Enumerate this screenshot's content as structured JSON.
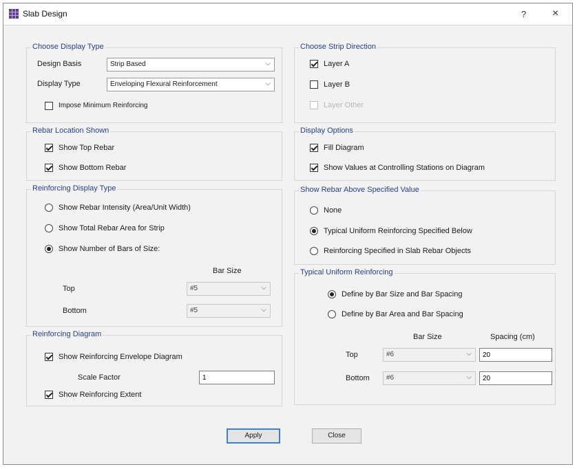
{
  "window": {
    "title": "Slab Design",
    "help_label": "?",
    "close_label": "×"
  },
  "display_type_group": {
    "title": "Choose Display Type",
    "design_basis_label": "Design Basis",
    "design_basis_value": "Strip Based",
    "display_type_label": "Display Type",
    "display_type_value": "Enveloping Flexural Reinforcement",
    "impose_min_label": "Impose Minimum Reinforcing",
    "impose_min_checked": false
  },
  "strip_direction_group": {
    "title": "Choose Strip Direction",
    "layer_a_label": "Layer A",
    "layer_a_checked": true,
    "layer_b_label": "Layer B",
    "layer_b_checked": false,
    "layer_other_label": "Layer Other",
    "layer_other_enabled": false
  },
  "rebar_location_group": {
    "title": "Rebar Location Shown",
    "show_top_label": "Show Top Rebar",
    "show_top_checked": true,
    "show_bottom_label": "Show Bottom Rebar",
    "show_bottom_checked": true
  },
  "display_options_group": {
    "title": "Display Options",
    "fill_diagram_label": "Fill Diagram",
    "fill_diagram_checked": true,
    "show_values_label": "Show Values at Controlling Stations on Diagram",
    "show_values_checked": true
  },
  "reinforcing_display_group": {
    "title": "Reinforcing Display Type",
    "option1_label": "Show Rebar Intensity (Area/Unit Width)",
    "option2_label": "Show Total Rebar Area for Strip",
    "option3_label": "Show Number of Bars of Size:",
    "selected_option": 3,
    "bar_size_header": "Bar Size",
    "top_label": "Top",
    "top_bar_size": "#5",
    "bottom_label": "Bottom",
    "bottom_bar_size": "#5"
  },
  "show_rebar_above_group": {
    "title": "Show Rebar Above Specified Value",
    "option_none_label": "None",
    "option_typical_label": "Typical Uniform Reinforcing Specified Below",
    "option_slab_rebar_label": "Reinforcing Specified in Slab Rebar Objects",
    "selected_option": 2
  },
  "typical_uniform_group": {
    "title": "Typical Uniform Reinforcing",
    "define_bar_size_label": "Define by Bar Size and Bar Spacing",
    "define_bar_area_label": "Define by Bar Area and Bar Spacing",
    "selected_option": 1,
    "bar_size_header": "Bar Size",
    "spacing_header": "Spacing  (cm)",
    "top_label": "Top",
    "top_bar_size": "#6",
    "top_spacing": "20",
    "bottom_label": "Bottom",
    "bottom_bar_size": "#6",
    "bottom_spacing": "20"
  },
  "reinforcing_diagram_group": {
    "title": "Reinforcing Diagram",
    "show_envelope_label": "Show Reinforcing Envelope Diagram",
    "show_envelope_checked": true,
    "scale_factor_label": "Scale Factor",
    "scale_factor_value": "1",
    "show_extent_label": "Show Reinforcing Extent",
    "show_extent_checked": true
  },
  "buttons": {
    "apply_label": "Apply",
    "close_label": "Close"
  },
  "colors": {
    "group_title": "#27408b",
    "dialog_bg": "#f2f2f2",
    "default_button_border": "#3c7fd6"
  },
  "icons": {
    "app_icon": "slab-design-grid-icon",
    "dropdown": "chevron-down-icon",
    "help": "help-icon",
    "close": "close-icon"
  }
}
